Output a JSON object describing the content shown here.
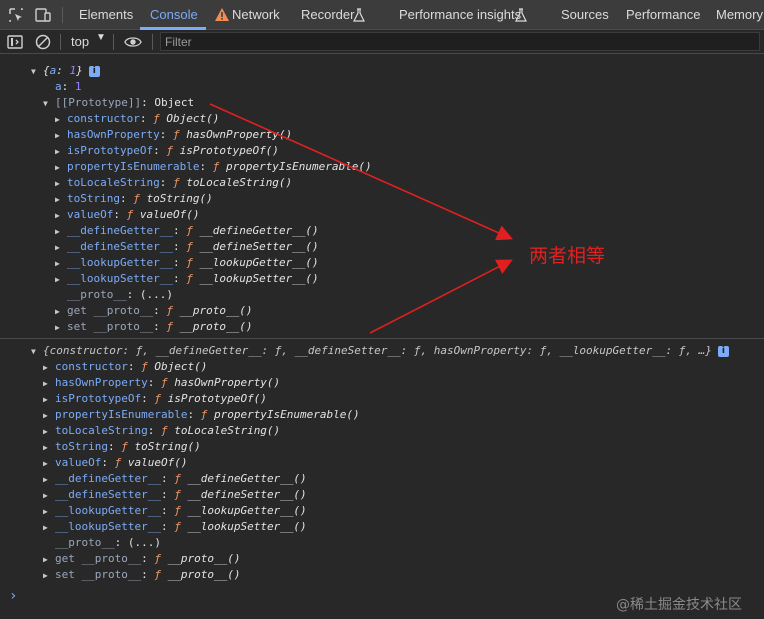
{
  "tabs": [
    "Elements",
    "Console",
    "Network",
    "Recorder",
    "Performance insights",
    "Sources",
    "Performance",
    "Memory"
  ],
  "toolbar": {
    "context": "top",
    "filter_placeholder": "Filter"
  },
  "obj1": {
    "summary_open": "{",
    "summary_key": "a",
    "summary_sep": ": ",
    "summary_val": "1",
    "summary_close": "}",
    "a_key": "a",
    "a_val": "1",
    "proto_key": "[[Prototype]]",
    "proto_val": "Object",
    "members": [
      {
        "key": "constructor",
        "fn": "Object()"
      },
      {
        "key": "hasOwnProperty",
        "fn": "hasOwnProperty()"
      },
      {
        "key": "isPrototypeOf",
        "fn": "isPrototypeOf()"
      },
      {
        "key": "propertyIsEnumerable",
        "fn": "propertyIsEnumerable()"
      },
      {
        "key": "toLocaleString",
        "fn": "toLocaleString()"
      },
      {
        "key": "toString",
        "fn": "toString()"
      },
      {
        "key": "valueOf",
        "fn": "valueOf()"
      },
      {
        "key": "__defineGetter__",
        "fn": "__defineGetter__()"
      },
      {
        "key": "__defineSetter__",
        "fn": "__defineSetter__()"
      },
      {
        "key": "__lookupGetter__",
        "fn": "__lookupGetter__()"
      },
      {
        "key": "__lookupSetter__",
        "fn": "__lookupSetter__()"
      }
    ],
    "proto_getter": "__proto__",
    "proto_getter_val": "(...)",
    "get_key": "get __proto__",
    "get_fn": "__proto__()",
    "set_key": "set __proto__",
    "set_fn": "__proto__()"
  },
  "obj2": {
    "summary": "{constructor: ƒ, __defineGetter__: ƒ, __defineSetter__: ƒ, hasOwnProperty: ƒ, __lookupGetter__: ƒ, …}",
    "members": [
      {
        "key": "constructor",
        "fn": "Object()"
      },
      {
        "key": "hasOwnProperty",
        "fn": "hasOwnProperty()"
      },
      {
        "key": "isPrototypeOf",
        "fn": "isPrototypeOf()"
      },
      {
        "key": "propertyIsEnumerable",
        "fn": "propertyIsEnumerable()"
      },
      {
        "key": "toLocaleString",
        "fn": "toLocaleString()"
      },
      {
        "key": "toString",
        "fn": "toString()"
      },
      {
        "key": "valueOf",
        "fn": "valueOf()"
      },
      {
        "key": "__defineGetter__",
        "fn": "__defineGetter__()"
      },
      {
        "key": "__defineSetter__",
        "fn": "__defineSetter__()"
      },
      {
        "key": "__lookupGetter__",
        "fn": "__lookupGetter__()"
      },
      {
        "key": "__lookupSetter__",
        "fn": "__lookupSetter__()"
      }
    ],
    "proto_getter": "__proto__",
    "proto_getter_val": "(...)",
    "get_key": "get __proto__",
    "get_fn": "__proto__()",
    "set_key": "set __proto__",
    "set_fn": "__proto__()"
  },
  "fn_marker": "ƒ",
  "info_glyph": "i",
  "annotation": "两者相等",
  "watermark": "@稀土掘金技术社区",
  "prompt_glyph": "›",
  "colors": {
    "accent": "#7cacf8",
    "function": "#f29766",
    "number": "#9980ff",
    "annotation": "#e02020",
    "background": "#282828"
  },
  "icons": [
    "inspect-element-icon",
    "device-toolbar-icon",
    "warning-icon",
    "flask-icon",
    "sidebar-toggle-icon",
    "clear-console-icon",
    "eye-icon",
    "info-icon"
  ]
}
